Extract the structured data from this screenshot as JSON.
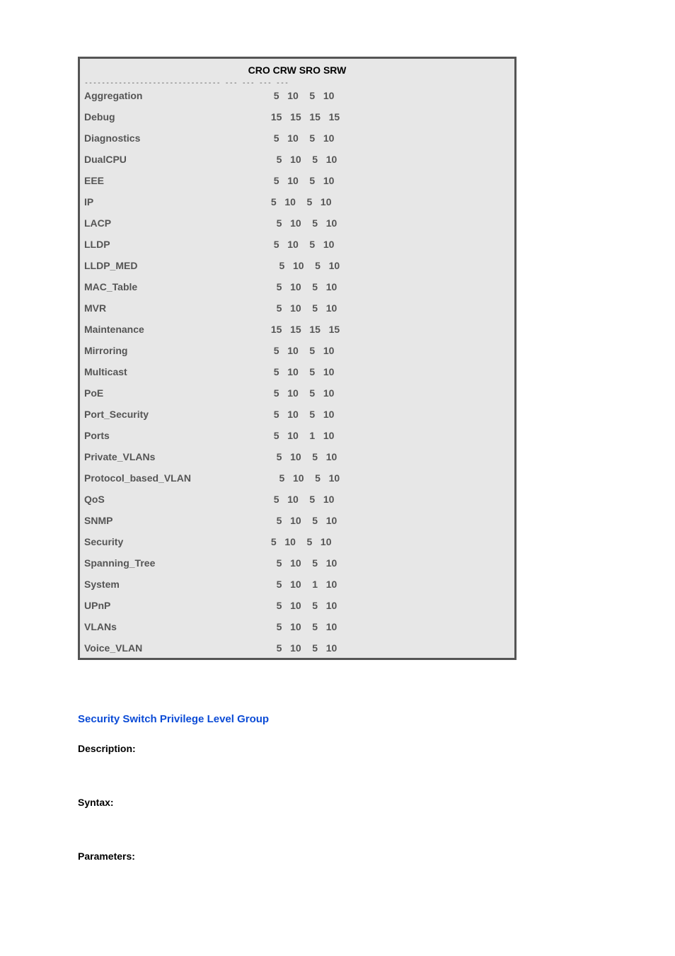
{
  "table": {
    "header": "CRO CRW SRO SRW",
    "divider": "-------------------------------- --- --- --- ---",
    "rows": [
      {
        "name": "Aggregation",
        "vals": "  5   10    5   10"
      },
      {
        "name": "Debug",
        "vals": " 15   15   15   15"
      },
      {
        "name": "Diagnostics",
        "vals": "  5   10    5   10"
      },
      {
        "name": "DualCPU",
        "vals": "   5   10    5   10"
      },
      {
        "name": "EEE",
        "vals": "  5   10    5   10"
      },
      {
        "name": "IP",
        "vals": " 5   10    5   10"
      },
      {
        "name": "LACP",
        "vals": "   5   10    5   10"
      },
      {
        "name": "LLDP",
        "vals": "  5   10    5   10"
      },
      {
        "name": "LLDP_MED",
        "vals": "    5   10    5   10"
      },
      {
        "name": "MAC_Table",
        "vals": "   5   10    5   10"
      },
      {
        "name": "MVR",
        "vals": "   5   10    5   10"
      },
      {
        "name": "Maintenance",
        "vals": " 15   15   15   15"
      },
      {
        "name": "Mirroring",
        "vals": "  5   10    5   10"
      },
      {
        "name": "Multicast",
        "vals": "  5   10    5   10"
      },
      {
        "name": "PoE",
        "vals": "  5   10    5   10"
      },
      {
        "name": "Port_Security",
        "vals": "  5   10    5   10"
      },
      {
        "name": "Ports",
        "vals": "  5   10    1   10"
      },
      {
        "name": "Private_VLANs",
        "vals": "   5   10    5   10"
      },
      {
        "name": "Protocol_based_VLAN",
        "vals": "    5   10    5   10"
      },
      {
        "name": "QoS",
        "vals": "  5   10    5   10"
      },
      {
        "name": "SNMP",
        "vals": "   5   10    5   10"
      },
      {
        "name": "Security",
        "vals": " 5   10    5   10"
      },
      {
        "name": "Spanning_Tree",
        "vals": "   5   10    5   10"
      },
      {
        "name": "System",
        "vals": "   5   10    1   10"
      },
      {
        "name": "UPnP",
        "vals": "   5   10    5   10"
      },
      {
        "name": "VLANs",
        "vals": "   5   10    5   10"
      },
      {
        "name": "Voice_VLAN",
        "vals": "   5   10    5   10"
      }
    ]
  },
  "section_title": "Security Switch Privilege Level Group",
  "labels": {
    "description": "Description:",
    "syntax": "Syntax:",
    "parameters": "Parameters:"
  }
}
